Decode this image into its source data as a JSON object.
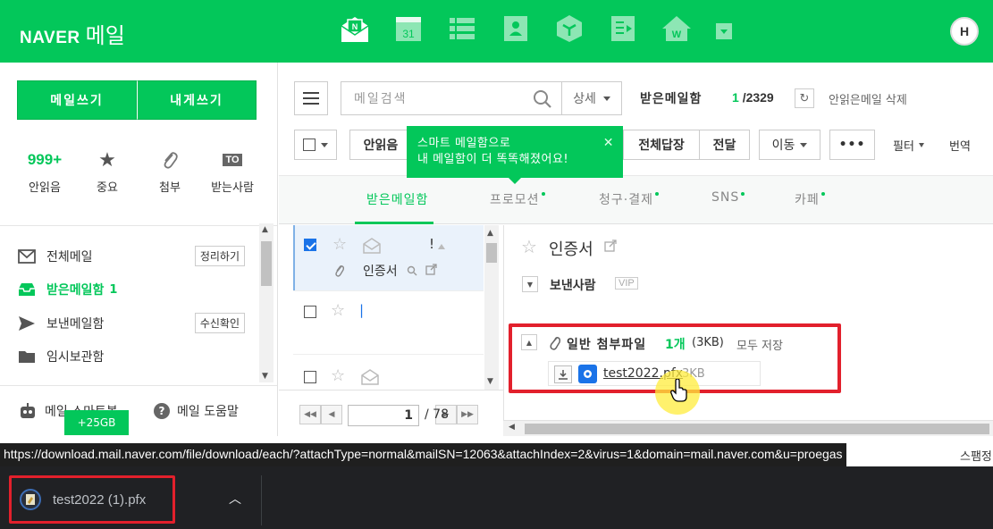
{
  "header": {
    "logo_brand": "NAVER",
    "logo_product": "메일",
    "avatar_label": "H"
  },
  "colors": {
    "brand": "#03c75a",
    "highlight_red": "#e2202c"
  },
  "sidebar": {
    "write_label": "메일쓰기",
    "write_to_me_label": "내게쓰기",
    "quick": {
      "unread_count": "999+",
      "unread_label": "안읽음",
      "important_label": "중요",
      "attach_label": "첨부",
      "to_badge": "TO",
      "to_label": "받는사람"
    },
    "folders": [
      {
        "label": "전체메일",
        "button": "정리하기"
      },
      {
        "label": "받은메일함",
        "count": "1"
      },
      {
        "label": "보낸메일함",
        "button": "수신확인"
      },
      {
        "label": "임시보관함"
      }
    ],
    "bottom": {
      "smart_label": "메일 스마트봇",
      "help_label": "메일 도움말",
      "storage_tip": "+25GB"
    }
  },
  "toolbar": {
    "search_placeholder": "메일검색",
    "detail_label": "상세",
    "inbox_title": "받은메일함",
    "inbox_unread": "1",
    "inbox_total": "/2329",
    "delete_unread": "안읽은메일 삭제",
    "read_label": "안읽음",
    "reply_all_label": "전체답장",
    "forward_label": "전달",
    "move_label": "이동",
    "more_label": "•••",
    "filter_label": "필터",
    "translate_label": "번역"
  },
  "tooltip": {
    "line1": "스마트 메일함으로",
    "line2": "내 메일함이 더 똑똑해졌어요!",
    "close": "✕"
  },
  "tabs": [
    {
      "label": "받은메일함"
    },
    {
      "label": "프로모션"
    },
    {
      "label": "청구·결제"
    },
    {
      "label": "SNS"
    },
    {
      "label": "카페"
    }
  ],
  "mail_list": {
    "row1_flag": "!",
    "row1_subject": "인증서",
    "row2_sender": "|"
  },
  "pager": {
    "current": "1",
    "total": "/ 78"
  },
  "reading": {
    "subject": "인증서",
    "sender_label": "보낸사람",
    "vip": "VIP",
    "attach_title": "일반 첨부파일",
    "attach_count": "1개",
    "attach_size": "(3KB)",
    "save_all": "모두 저장",
    "file_name": "test2022.pfx",
    "file_size": "3KB",
    "spam_label": "스팸정"
  },
  "status_url": "https://download.mail.naver.com/file/download/each/?attachType=normal&mailSN=12063&attachIndex=2&virus=1&domain=mail.naver.com&u=proegas",
  "download_bar": {
    "file_name": "test2022 (1).pfx"
  }
}
